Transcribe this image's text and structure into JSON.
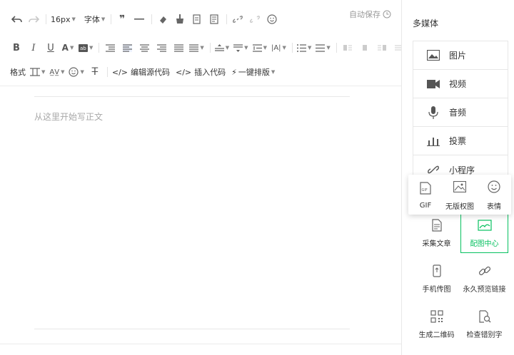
{
  "toolbar": {
    "font_size": "16px",
    "font_family": "字体",
    "autosave": "自动保存",
    "format_brush": "格式",
    "view_source": "编辑源代码",
    "insert_code": "插入代码",
    "one_click_layout": "一键排版"
  },
  "editor": {
    "placeholder": "从这里开始写正文"
  },
  "sidebar": {
    "title": "多媒体",
    "media": [
      {
        "label": "图片",
        "icon": "image-icon"
      },
      {
        "label": "视频",
        "icon": "video-icon"
      },
      {
        "label": "音频",
        "icon": "microphone-icon"
      },
      {
        "label": "投票",
        "icon": "bar-chart-icon"
      },
      {
        "label": "小程序",
        "icon": "link-icon"
      }
    ],
    "popup": [
      {
        "label": "GIF",
        "icon": "gif-icon"
      },
      {
        "label": "无版权图",
        "icon": "image-icon"
      },
      {
        "label": "表情",
        "icon": "smiley-icon"
      }
    ],
    "tools": [
      {
        "label": "采集文章",
        "icon": "document-icon"
      },
      {
        "label": "配图中心",
        "icon": "picture-center-icon",
        "active": true
      },
      {
        "label": "手机传图",
        "icon": "phone-upload-icon"
      },
      {
        "label": "永久预览链接",
        "icon": "chain-link-icon"
      },
      {
        "label": "生成二维码",
        "icon": "qr-code-icon"
      },
      {
        "label": "检查错别字",
        "icon": "typo-check-icon"
      }
    ]
  },
  "colors": {
    "accent": "#07c160",
    "border": "#e7e7e7",
    "placeholder": "#a8a8a8"
  }
}
